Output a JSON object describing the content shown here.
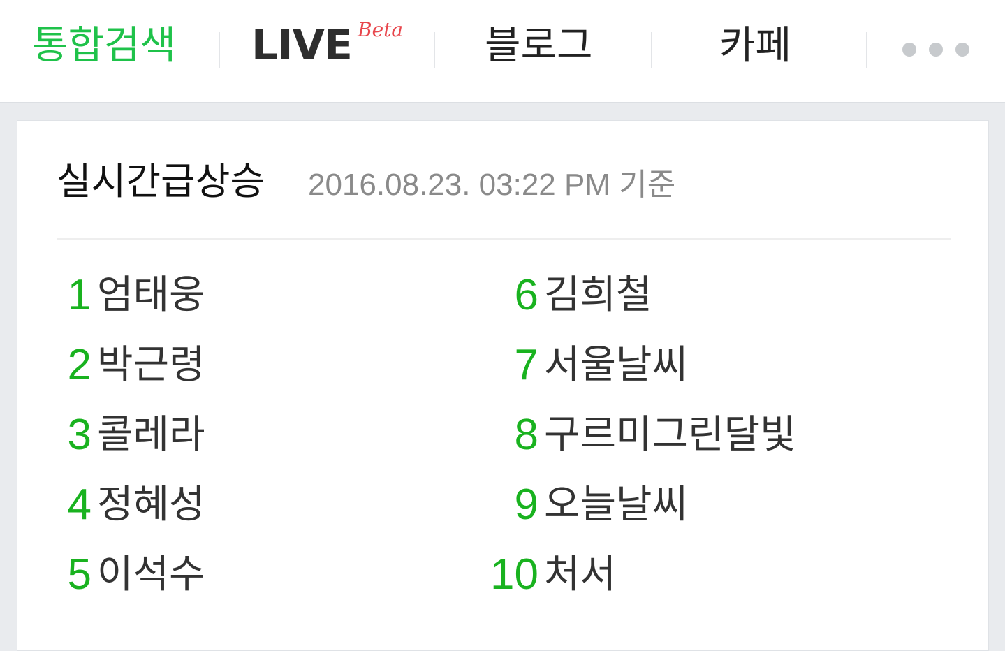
{
  "nav": {
    "tabs": [
      {
        "label": "통합검색",
        "active": true
      },
      {
        "label": "LIVE",
        "badge": "Beta"
      },
      {
        "label": "블로그"
      },
      {
        "label": "카페"
      }
    ],
    "more_icon": "more-dots-icon"
  },
  "trending": {
    "title": "실시간급상승",
    "timestamp": "2016.08.23. 03:22 PM 기준",
    "items": [
      {
        "rank": "1",
        "keyword": "엄태웅"
      },
      {
        "rank": "2",
        "keyword": "박근령"
      },
      {
        "rank": "3",
        "keyword": "콜레라"
      },
      {
        "rank": "4",
        "keyword": "정혜성"
      },
      {
        "rank": "5",
        "keyword": "이석수"
      },
      {
        "rank": "6",
        "keyword": "김희철"
      },
      {
        "rank": "7",
        "keyword": "서울날씨"
      },
      {
        "rank": "8",
        "keyword": "구르미그린달빛"
      },
      {
        "rank": "9",
        "keyword": "오늘날씨"
      },
      {
        "rank": "10",
        "keyword": "처서"
      }
    ]
  },
  "colors": {
    "accent_green": "#1fc24a",
    "rank_green": "#19b21f",
    "beta_red": "#e8474d",
    "background": "#e9ebee"
  }
}
